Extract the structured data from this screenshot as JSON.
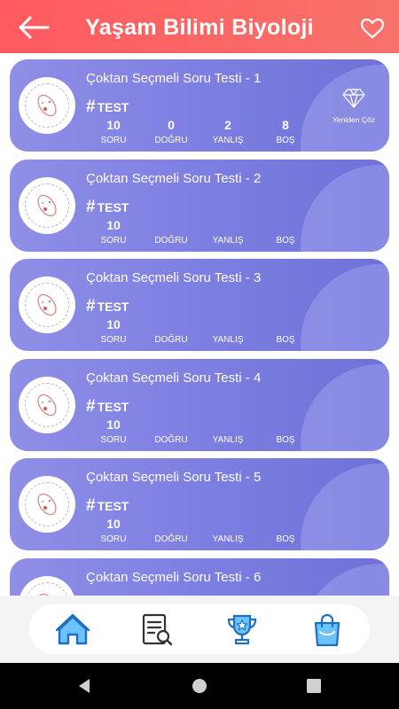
{
  "header": {
    "title": "Yaşam Bilimi Biyoloji",
    "back_icon": "arrow-left-icon",
    "favorite_icon": "heart-outline-icon"
  },
  "colors": {
    "header_start": "#ff5a5f",
    "header_end": "#f8726b",
    "card_start": "#8f8fe7",
    "card_end": "#6e71d8",
    "nav_active": "#3aa0f0"
  },
  "labels": {
    "tag": "TEST",
    "soru": "SORU",
    "dogru": "DOĞRU",
    "yanlis": "YANLIŞ",
    "bos": "BOŞ",
    "redo": "Yeniden Çöz"
  },
  "tests": [
    {
      "title": "Çoktan Seçmeli Soru Testi - 1",
      "soru": "10",
      "dogru": "0",
      "yanlis": "2",
      "bos": "8",
      "completed": true
    },
    {
      "title": "Çoktan Seçmeli Soru Testi - 2",
      "soru": "10",
      "dogru": "",
      "yanlis": "",
      "bos": "",
      "completed": false
    },
    {
      "title": "Çoktan Seçmeli Soru Testi - 3",
      "soru": "10",
      "dogru": "",
      "yanlis": "",
      "bos": "",
      "completed": false
    },
    {
      "title": "Çoktan Seçmeli Soru Testi - 4",
      "soru": "10",
      "dogru": "",
      "yanlis": "",
      "bos": "",
      "completed": false
    },
    {
      "title": "Çoktan Seçmeli Soru Testi - 5",
      "soru": "10",
      "dogru": "",
      "yanlis": "",
      "bos": "",
      "completed": false
    },
    {
      "title": "Çoktan Seçmeli Soru Testi - 6",
      "soru": "",
      "dogru": "",
      "yanlis": "",
      "bos": "",
      "completed": false
    }
  ],
  "bottom_nav": [
    {
      "icon": "home-icon",
      "active": true
    },
    {
      "icon": "search-list-icon",
      "active": false
    },
    {
      "icon": "trophy-icon",
      "active": false
    },
    {
      "icon": "shopping-bag-icon",
      "active": false
    }
  ],
  "system_nav": [
    "back-triangle-icon",
    "home-circle-icon",
    "recents-square-icon"
  ]
}
